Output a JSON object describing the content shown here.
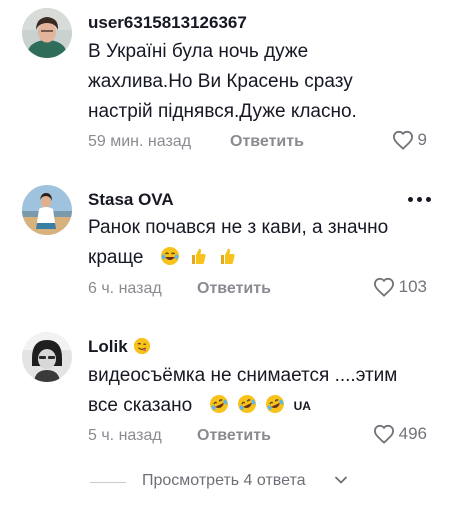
{
  "comments": [
    {
      "username": "user6315813126367",
      "text_lines": [
        "В Україні була ночь дуже",
        "жахлива.Но Ви Красень сразу",
        "настрій піднявся.Дуже класно."
      ],
      "time": "59 мин. назад",
      "reply_label": "Ответить",
      "likes": "9",
      "avatar_icon": "user-avatar-photo"
    },
    {
      "username": "Stasa OVA",
      "text_lines": [
        "Ранок почався не з кави, а значно",
        "краще"
      ],
      "emojis": [
        "laughing-tears-emoji",
        "thumbs-up-emoji",
        "thumbs-up-emoji"
      ],
      "time": "6 ч. назад",
      "reply_label": "Ответить",
      "likes": "103",
      "avatar_icon": "user-avatar-photo"
    },
    {
      "username": "Lolik",
      "username_emoji": "winking-emoji",
      "text_lines": [
        "видеосъёмка не снимается ....этим",
        "все сказано"
      ],
      "emojis": [
        "rolling-laughing-emoji",
        "rolling-laughing-emoji",
        "rolling-laughing-emoji"
      ],
      "badge": "UA",
      "time": "5 ч. назад",
      "reply_label": "Ответить",
      "likes": "496",
      "avatar_icon": "user-avatar-photo"
    }
  ],
  "view_more": {
    "label": "Просмотреть 4 ответа",
    "icon": "chevron-down-icon"
  },
  "colors": {
    "text": "#161823",
    "muted": "#8a8b91",
    "emoji_yellow": "#f7c21b"
  }
}
